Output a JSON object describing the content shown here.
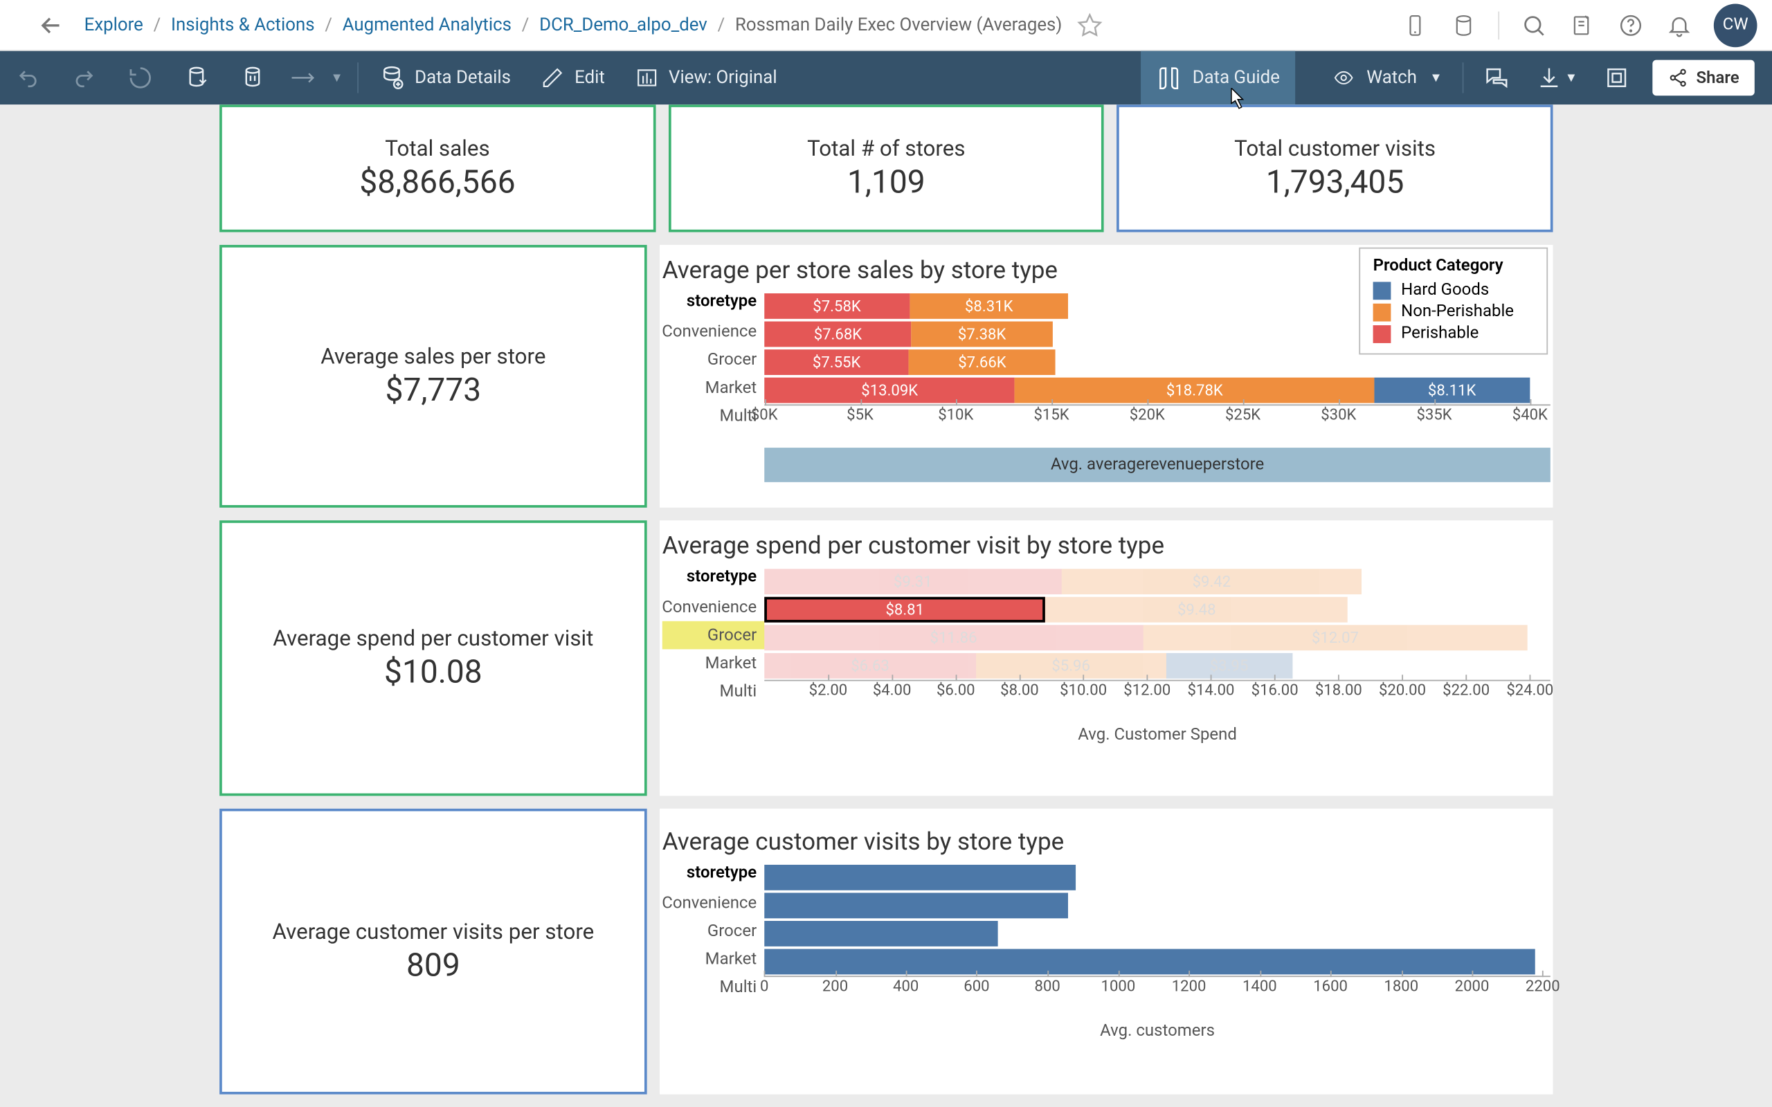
{
  "breadcrumb": {
    "items": [
      "Explore",
      "Insights & Actions",
      "Augmented Analytics",
      "DCR_Demo_alpo_dev"
    ],
    "current": "Rossman Daily Exec Overview (Averages)"
  },
  "avatar_initials": "CW",
  "toolbar": {
    "data_details": "Data Details",
    "edit": "Edit",
    "view": "View: Original",
    "data_guide": "Data Guide",
    "watch": "Watch",
    "share": "Share"
  },
  "kpis_top": [
    {
      "label": "Total sales",
      "value": "$8,866,566",
      "color": "green"
    },
    {
      "label": "Total # of stores",
      "value": "1,109",
      "color": "green"
    },
    {
      "label": "Total customer visits",
      "value": "1,793,405",
      "color": "blue"
    }
  ],
  "kpis_left": [
    {
      "label": "Average sales per store",
      "value": "$7,773",
      "color": "green"
    },
    {
      "label": "Average spend per customer visit",
      "value": "$10.08",
      "color": "green"
    },
    {
      "label": "Average customer visits per store",
      "value": "809",
      "color": "blue"
    }
  ],
  "legend": {
    "title": "Product Category",
    "items": [
      {
        "label": "Hard Goods",
        "color": "#4c78a8"
      },
      {
        "label": "Non-Perishable",
        "color": "#ef8e3e"
      },
      {
        "label": "Perishable",
        "color": "#e45756"
      }
    ]
  },
  "chart_data": [
    {
      "id": "avg_sales",
      "type": "bar",
      "title": "Average per store sales by store type",
      "row_label": "storetype",
      "xlabel": "Avg. averagerevenueperstore",
      "categories": [
        "Convenience",
        "Grocer",
        "Market",
        "Multi"
      ],
      "series": [
        {
          "name": "Perishable",
          "values_label": [
            "$7.58K",
            "$7.68K",
            "$7.55K",
            "$13.09K"
          ],
          "values": [
            7580,
            7680,
            7550,
            13090
          ]
        },
        {
          "name": "Non-Perishable",
          "values_label": [
            "$8.31K",
            "$7.38K",
            "$7.66K",
            "$18.78K"
          ],
          "values": [
            8310,
            7380,
            7660,
            18780
          ]
        },
        {
          "name": "Hard Goods",
          "values_label": [
            "",
            "",
            "",
            "$8.11K"
          ],
          "values": [
            0,
            0,
            0,
            8110
          ]
        }
      ],
      "xticks": [
        "$0K",
        "$5K",
        "$10K",
        "$15K",
        "$20K",
        "$25K",
        "$30K",
        "$35K",
        "$40K"
      ],
      "xmax": 40000,
      "axis_band": true
    },
    {
      "id": "avg_spend",
      "type": "bar",
      "title": "Average spend per customer visit by store type",
      "row_label": "storetype",
      "xlabel": "Avg. Customer Spend",
      "categories": [
        "Convenience",
        "Grocer",
        "Market",
        "Multi"
      ],
      "series": [
        {
          "name": "Perishable",
          "values_label": [
            "$9.31",
            "$8.81",
            "$11.86",
            "$6.63"
          ],
          "values": [
            9.31,
            8.81,
            11.86,
            6.63
          ]
        },
        {
          "name": "Non-Perishable",
          "values_label": [
            "$9.42",
            "$9.48",
            "$12.07",
            "$5.96"
          ],
          "values": [
            9.42,
            9.48,
            12.07,
            5.96
          ]
        },
        {
          "name": "Hard Goods",
          "values_label": [
            "",
            "",
            "",
            "$3.95"
          ],
          "values": [
            0,
            0,
            0,
            3.95
          ]
        }
      ],
      "highlighted_row": 1,
      "highlighted_series": 0,
      "xticks": [
        "$2.00",
        "$4.00",
        "$6.00",
        "$8.00",
        "$10.00",
        "$12.00",
        "$14.00",
        "$16.00",
        "$18.00",
        "$20.00",
        "$22.00",
        "$24.00"
      ],
      "xmin": 0,
      "xmax": 24,
      "axis_band": false
    },
    {
      "id": "avg_visits",
      "type": "bar",
      "title": "Average customer visits by store type",
      "row_label": "storetype",
      "xlabel": "Avg. customers",
      "categories": [
        "Convenience",
        "Grocer",
        "Market",
        "Multi"
      ],
      "values": [
        880,
        860,
        660,
        2180
      ],
      "xticks": [
        "0",
        "200",
        "400",
        "600",
        "800",
        "1000",
        "1200",
        "1400",
        "1600",
        "1800",
        "2000",
        "2200"
      ],
      "xmax": 2200,
      "axis_band": false
    }
  ]
}
